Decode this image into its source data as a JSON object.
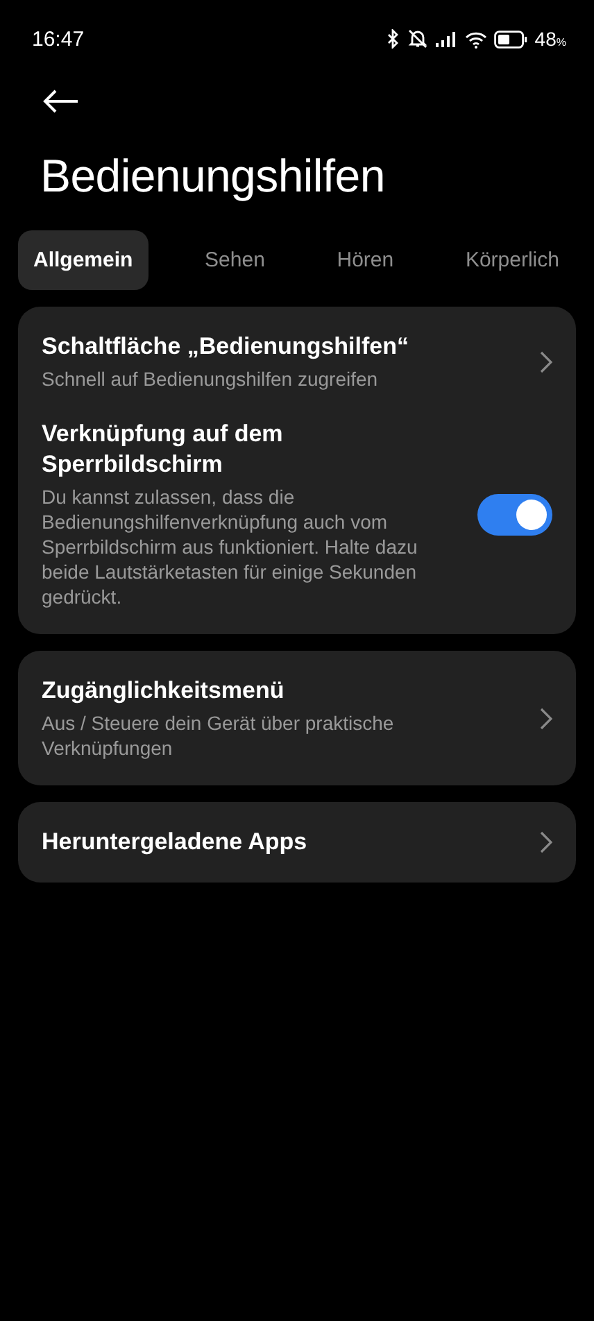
{
  "status_bar": {
    "time": "16:47",
    "battery": "48",
    "battery_unit": "%"
  },
  "header": {
    "title": "Bedienungshilfen"
  },
  "tabs": [
    {
      "label": "Allgemein",
      "selected": true
    },
    {
      "label": "Sehen",
      "selected": false
    },
    {
      "label": "Hören",
      "selected": false
    },
    {
      "label": "Körperlich",
      "selected": false
    }
  ],
  "groups": [
    {
      "items": [
        {
          "kind": "link",
          "title": "Schaltfläche „Bedienungshilfen“",
          "subtitle": "Schnell auf Bedienungshilfen zugreifen"
        },
        {
          "kind": "toggle",
          "title": "Verknüpfung auf dem Sperrbildschirm",
          "subtitle": "Du kannst zulassen, dass die Bedienungshilfenverknüpfung auch vom Sperrbildschirm aus funktioniert. Halte dazu beide Lautstärketasten für einige Sekunden gedrückt.",
          "on": true
        }
      ]
    },
    {
      "items": [
        {
          "kind": "link",
          "title": "Zugänglichkeitsmenü",
          "subtitle": "Aus / Steuere dein Gerät über praktische Verknüpfungen"
        }
      ]
    },
    {
      "items": [
        {
          "kind": "link",
          "title": "Heruntergeladene Apps"
        }
      ]
    }
  ]
}
